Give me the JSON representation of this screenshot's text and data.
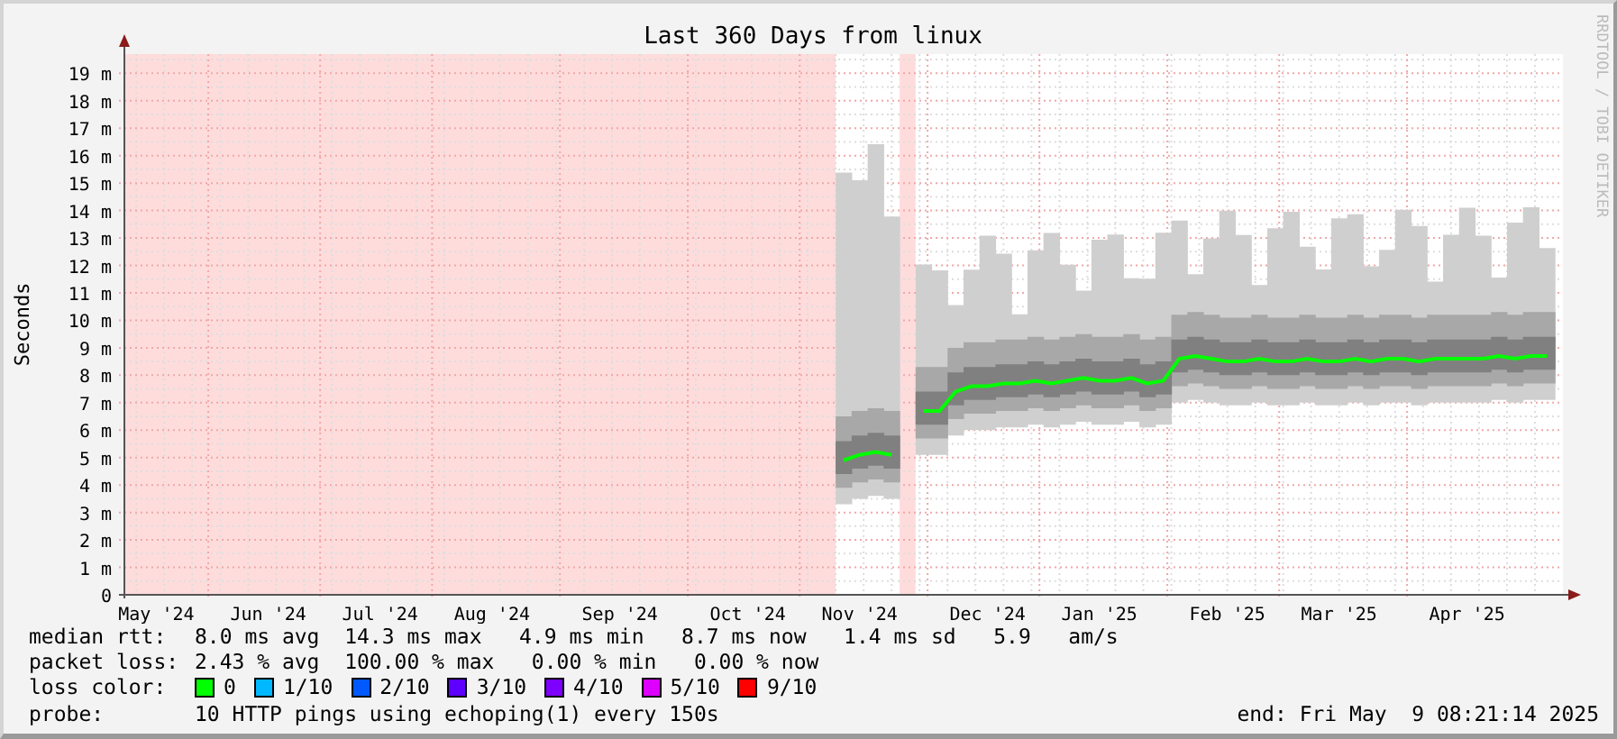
{
  "chart": {
    "chart_data": {
      "type": "line",
      "title": "Last 360 Days from linux",
      "ylabel": "Seconds",
      "categories": [
        null,
        null,
        "May '24",
        null,
        null,
        null,
        null,
        null,
        null,
        "Jun '24",
        null,
        null,
        null,
        null,
        null,
        null,
        "Jul '24",
        null,
        null,
        null,
        null,
        null,
        null,
        "Aug '24",
        null,
        null,
        null,
        null,
        null,
        null,
        null,
        "Sep '24",
        null,
        null,
        null,
        null,
        null,
        null,
        null,
        "Oct '24",
        null,
        null,
        null,
        null,
        null,
        null,
        "Nov '24",
        null,
        null,
        null,
        null,
        null,
        null,
        null,
        "Dec '24",
        null,
        null,
        null,
        null,
        null,
        null,
        "Jan '25",
        null,
        null,
        null,
        null,
        null,
        null,
        null,
        "Feb '25",
        null,
        null,
        null,
        null,
        null,
        null,
        "Mar '25",
        null,
        null,
        null,
        null,
        null,
        null,
        null,
        "Apr '25",
        null,
        null,
        null,
        null,
        null
      ],
      "series": [
        {
          "color": "#00ff00",
          "values": [
            null,
            null,
            null,
            null,
            null,
            null,
            null,
            null,
            null,
            null,
            null,
            null,
            null,
            null,
            null,
            null,
            null,
            null,
            null,
            null,
            null,
            null,
            null,
            null,
            null,
            null,
            null,
            null,
            null,
            null,
            null,
            null,
            null,
            null,
            null,
            null,
            null,
            null,
            null,
            null,
            null,
            null,
            null,
            null,
            null,
            4.9,
            5.1,
            5.2,
            5.1,
            null,
            6.7,
            6.7,
            7.4,
            7.6,
            7.6,
            7.7,
            7.7,
            7.8,
            7.7,
            7.8,
            7.9,
            7.8,
            7.8,
            7.9,
            7.7,
            7.8,
            8.6,
            8.7,
            8.6,
            8.5,
            8.5,
            8.6,
            8.5,
            8.5,
            8.6,
            8.5,
            8.5,
            8.6,
            8.5,
            8.6,
            8.6,
            8.5,
            8.6,
            8.6,
            8.6,
            8.6,
            8.7,
            8.6,
            8.7,
            8.7
          ]
        }
      ],
      "ylim": [
        0,
        19.7
      ],
      "grid": true,
      "yticks": [
        {
          "value": 0,
          "label": "0"
        },
        {
          "value": 1,
          "label": "1 m"
        },
        {
          "value": 2,
          "label": "2 m"
        },
        {
          "value": 3,
          "label": "3 m"
        },
        {
          "value": 4,
          "label": "4 m"
        },
        {
          "value": 5,
          "label": "5 m"
        },
        {
          "value": 6,
          "label": "6 m"
        },
        {
          "value": 7,
          "label": "7 m"
        },
        {
          "value": 8,
          "label": "8 m"
        },
        {
          "value": 9,
          "label": "9 m"
        },
        {
          "value": 10,
          "label": "10 m"
        },
        {
          "value": 11,
          "label": "11 m"
        },
        {
          "value": 12,
          "label": "12 m"
        },
        {
          "value": 13,
          "label": "13 m"
        },
        {
          "value": 14,
          "label": "14 m"
        },
        {
          "value": 15,
          "label": "15 m"
        },
        {
          "value": 16,
          "label": "16 m"
        },
        {
          "value": 17,
          "label": "17 m"
        },
        {
          "value": 18,
          "label": "18 m"
        },
        {
          "value": 19,
          "label": "19 m"
        }
      ]
    }
  },
  "credit": "RRDTOOL / TOBI OETIKER",
  "legend": {
    "median_rtt": {
      "label": "median rtt:",
      "value": "8.0 ms avg  14.3 ms max   4.9 ms min   8.7 ms now   1.4 ms sd   5.9   am/s"
    },
    "packet_loss": {
      "label": "packet loss:",
      "value": "2.43 % avg  100.00 % max   0.00 % min   0.00 % now"
    },
    "loss_color": {
      "label": "loss color:",
      "items": [
        {
          "label": "0",
          "color": "#00ff00"
        },
        {
          "label": "1/10",
          "color": "#00b8ff"
        },
        {
          "label": "2/10",
          "color": "#0059ff"
        },
        {
          "label": "3/10",
          "color": "#5e00ff"
        },
        {
          "label": "4/10",
          "color": "#7e00ff"
        },
        {
          "label": "5/10",
          "color": "#dd00ff"
        },
        {
          "label": "9/10",
          "color": "#ff0000"
        }
      ]
    },
    "probe": {
      "label": "probe:",
      "value": "10 HTTP pings using echoping(1) every 150s"
    },
    "end": "end: Fri May  9 08:21:14 2025"
  }
}
